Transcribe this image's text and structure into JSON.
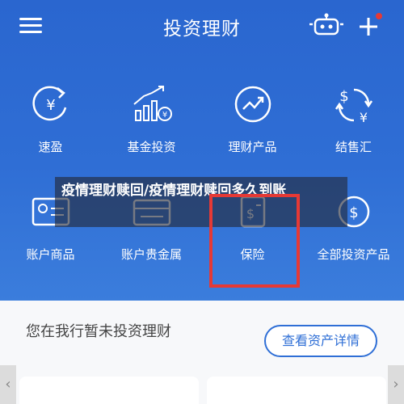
{
  "header": {
    "title": "投资理财",
    "menu_icon": "menu-icon",
    "service_icon": "robot-icon",
    "add_icon": "plus-icon",
    "badge_color": "#e53935"
  },
  "menu_row1": [
    {
      "label": "速盈",
      "icon": "yuan-cycle-icon"
    },
    {
      "label": "基金投资",
      "icon": "fund-chart-icon"
    },
    {
      "label": "理财产品",
      "icon": "trend-icon"
    },
    {
      "label": "结售汇",
      "icon": "currency-exchange-icon"
    }
  ],
  "menu_row2": [
    {
      "label": "账户商品",
      "icon": "account-goods-icon"
    },
    {
      "label": "账户贵金属",
      "icon": "precious-metal-icon"
    },
    {
      "label": "保险",
      "icon": "insurance-icon"
    },
    {
      "label": "全部投资产品",
      "icon": "all-products-icon"
    }
  ],
  "banner": {
    "text": "疫情理财赎回/疫情理财赎回多久到账"
  },
  "card": {
    "message": "您在我行暂未投资理财",
    "button": "查看资产详情"
  },
  "colors": {
    "brand_blue": "#2f6fd6",
    "highlight_red": "#e53935"
  }
}
